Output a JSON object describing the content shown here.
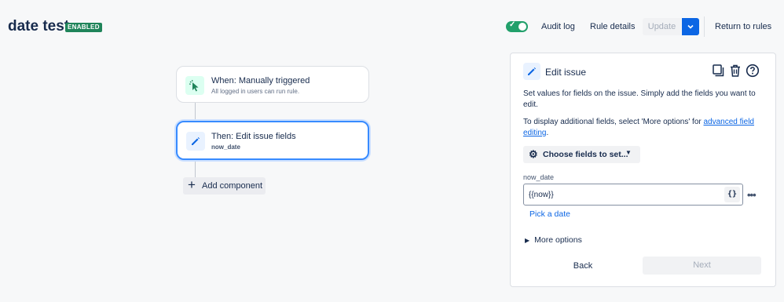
{
  "header": {
    "title": "date test",
    "status_badge": "ENABLED",
    "rule_enabled": true,
    "audit_log_label": "Audit log",
    "rule_details_label": "Rule details",
    "update_label": "Update",
    "return_label": "Return to rules"
  },
  "flow": {
    "trigger": {
      "title": "When: Manually triggered",
      "subtitle": "All logged in users can run rule.",
      "icon": "cursor-click-icon"
    },
    "action": {
      "title": "Then: Edit issue fields",
      "subtitle": "now_date",
      "icon": "pencil-icon"
    },
    "add_component_label": "Add component"
  },
  "panel": {
    "title": "Edit issue",
    "icon": "pencil-icon",
    "desc1": "Set values for fields on the issue. Simply add the fields you want to edit.",
    "desc2_prefix": "To display additional fields, select 'More options' for ",
    "desc2_link": "advanced field editing",
    "desc2_suffix": ".",
    "choose_fields_label": "Choose fields to set...",
    "field_label": "now_date",
    "field_value": "{{now}}",
    "smart_value_button": "{}",
    "pick_date_label": "Pick a date",
    "more_options_label": "More options",
    "back_label": "Back",
    "next_label": "Next"
  },
  "colors": {
    "accent": "#0c66e4",
    "enabled_green": "#1f845a",
    "selected_border": "#388bff"
  }
}
